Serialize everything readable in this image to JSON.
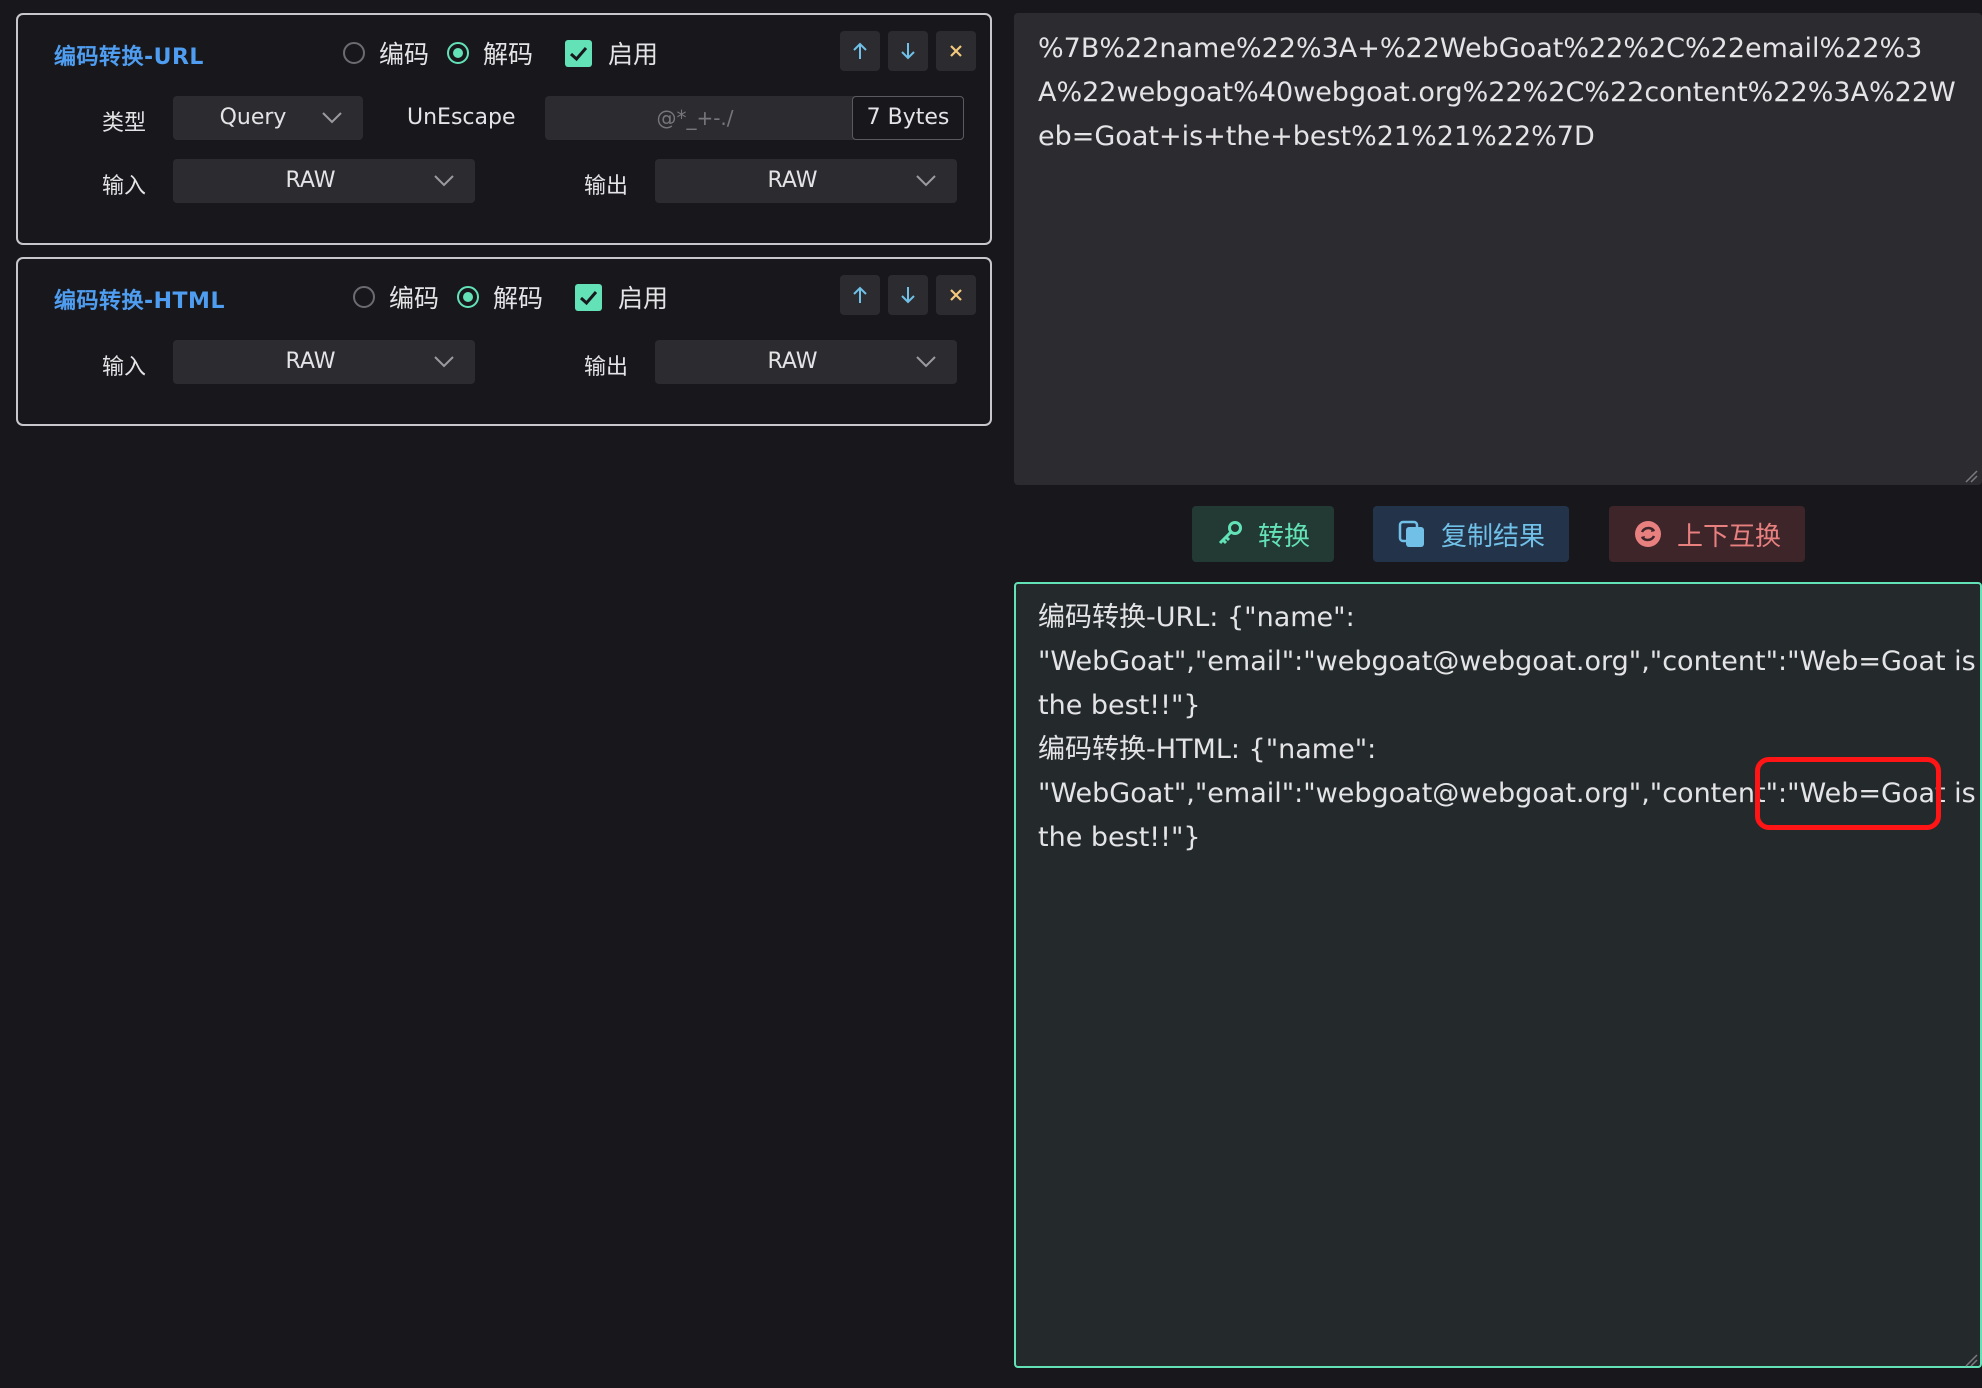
{
  "url_card": {
    "title": "编码转换-URL",
    "encode_label": "编码",
    "decode_label": "解码",
    "enable_label": "启用",
    "type_label": "类型",
    "type_value": "Query",
    "unescape_label": "UnEscape",
    "unescape_placeholder": "@*_+-./",
    "bytes_label": "7 Bytes",
    "input_label": "输入",
    "input_value": "RAW",
    "output_label": "输出",
    "output_value": "RAW",
    "mode": "decode",
    "enabled": true
  },
  "html_card": {
    "title": "编码转换-HTML",
    "encode_label": "编码",
    "decode_label": "解码",
    "enable_label": "启用",
    "input_label": "输入",
    "input_value": "RAW",
    "output_label": "输出",
    "output_value": "RAW",
    "mode": "decode",
    "enabled": true
  },
  "input_text": "%7B%22name%22%3A+%22WebGoat%22%2C%22email%22%3A%22webgoat%40webgoat.org%22%2C%22content%22%3A%22Web=Goat+is+the+best%21%21%22%7D",
  "actions": {
    "convert": "转换",
    "copy": "复制结果",
    "swap": "上下互换"
  },
  "output_lines": [
    "编码转换-URL: {\"name\":",
    "\"WebGoat\",\"email\":\"webgoat@webgoat.org\",\"content\":\"Web=Goat is",
    "the best!!\"}",
    "编码转换-HTML: {\"name\":",
    "\"WebGoat\",\"email\":\"webgoat@webgoat.org\",\"content\":\"Web=Goat is",
    "the best!!\"}"
  ],
  "colors": {
    "accent_green": "#63e2b7",
    "accent_blue": "#4f9df0",
    "highlight_red": "#ff1515"
  },
  "icons": {
    "move_up": "arrow-up-icon",
    "move_down": "arrow-down-icon",
    "remove": "close-icon",
    "convert": "key-icon",
    "copy": "copy-icon",
    "swap": "swap-icon"
  }
}
